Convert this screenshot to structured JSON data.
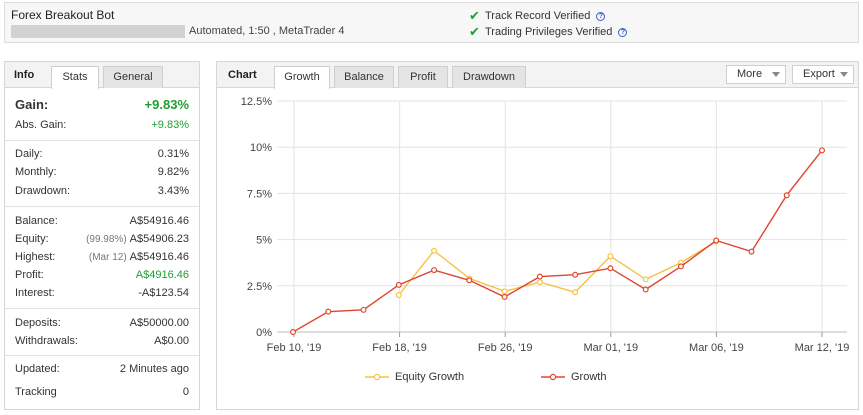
{
  "header": {
    "title": "Forex Breakout Bot",
    "meta": "Automated, 1:50 , MetaTrader 4",
    "verified": [
      {
        "label": "Track Record Verified"
      },
      {
        "label": "Trading Privileges Verified"
      }
    ]
  },
  "info": {
    "label": "Info",
    "tabs": [
      "Stats",
      "General"
    ],
    "gain": {
      "label": "Gain:",
      "value": "+9.83%"
    },
    "abs_gain": {
      "label": "Abs. Gain:",
      "value": "+9.83%"
    },
    "daily": {
      "label": "Daily:",
      "value": "0.31%"
    },
    "monthly": {
      "label": "Monthly:",
      "value": "9.82%"
    },
    "drawdown": {
      "label": "Drawdown:",
      "value": "3.43%"
    },
    "balance": {
      "label": "Balance:",
      "value": "A$54916.46"
    },
    "equity": {
      "label": "Equity:",
      "sub": "(99.98%)",
      "value": "A$54906.23"
    },
    "highest": {
      "label": "Highest:",
      "sub": "(Mar 12)",
      "value": "A$54916.46"
    },
    "profit": {
      "label": "Profit:",
      "value": "A$4916.46"
    },
    "interest": {
      "label": "Interest:",
      "value": "-A$123.54"
    },
    "deposits": {
      "label": "Deposits:",
      "value": "A$50000.00"
    },
    "withdrawals": {
      "label": "Withdrawals:",
      "value": "A$0.00"
    },
    "updated": {
      "label": "Updated:",
      "value": "2 Minutes ago"
    },
    "tracking": {
      "label": "Tracking",
      "value": "0"
    }
  },
  "chart_panel": {
    "label": "Chart",
    "tabs": [
      "Growth",
      "Balance",
      "Profit",
      "Drawdown"
    ],
    "more_label": "More",
    "export_label": "Export"
  },
  "colors": {
    "equity": "#f5c242",
    "growth": "#e0462e",
    "gain_green": "#1e9e32"
  },
  "chart_data": {
    "type": "line",
    "x_tick_labels": [
      "Feb 10, '19",
      "Feb 18, '19",
      "Feb 26, '19",
      "Mar 01, '19",
      "Mar 06, '19",
      "Mar 12, '19"
    ],
    "y_tick_labels": [
      "0%",
      "2.5%",
      "5%",
      "7.5%",
      "10%",
      "12.5%"
    ],
    "ylim": [
      0,
      12.5
    ],
    "grid": true,
    "legend_placement": "bottom",
    "series": [
      {
        "name": "Equity Growth",
        "values": [
          null,
          null,
          null,
          2.0,
          4.4,
          2.9,
          2.2,
          2.7,
          2.15,
          4.1,
          2.85,
          3.75,
          4.9,
          null,
          null
        ]
      },
      {
        "name": "Growth",
        "values": [
          0.0,
          1.1,
          1.2,
          2.55,
          3.35,
          2.8,
          1.9,
          3.0,
          3.1,
          3.45,
          2.3,
          3.55,
          4.95,
          4.35,
          7.4,
          9.83
        ]
      }
    ]
  }
}
